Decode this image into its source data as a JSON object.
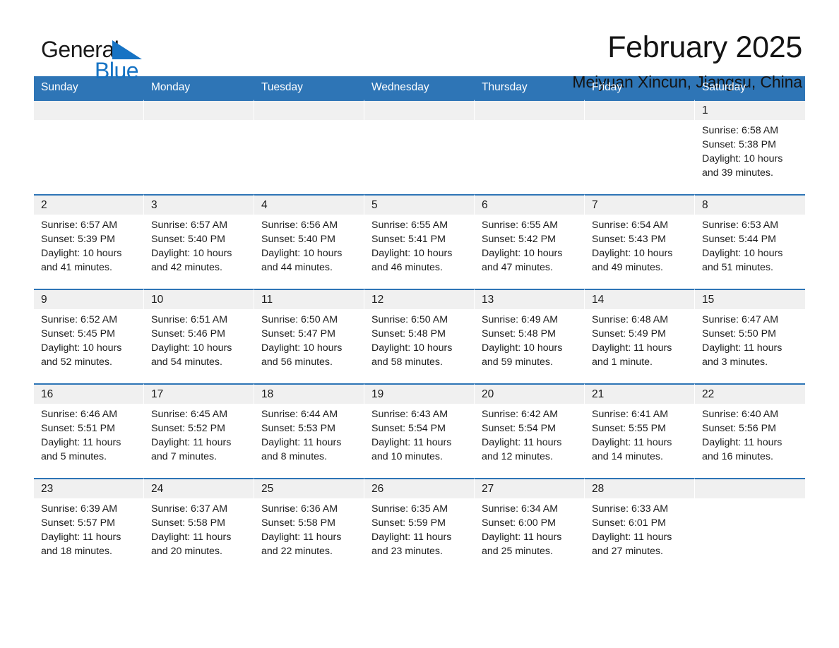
{
  "brand": {
    "word_one": "General",
    "word_two": "Blue",
    "triangle_icon": "triangle-icon"
  },
  "header": {
    "title": "February 2025",
    "subtitle": "Meiyuan Xincun, Jiangsu, China"
  },
  "colors": {
    "header_blue": "#2e75b6",
    "row_border_blue": "#2e75b6",
    "daynum_band": "#f0f0f0",
    "brand_blue": "#1673c4"
  },
  "calendar": {
    "weekday_headers": [
      "Sunday",
      "Monday",
      "Tuesday",
      "Wednesday",
      "Thursday",
      "Friday",
      "Saturday"
    ],
    "weeks": [
      [
        {
          "day": "",
          "sunrise": "",
          "sunset": "",
          "daylight": ""
        },
        {
          "day": "",
          "sunrise": "",
          "sunset": "",
          "daylight": ""
        },
        {
          "day": "",
          "sunrise": "",
          "sunset": "",
          "daylight": ""
        },
        {
          "day": "",
          "sunrise": "",
          "sunset": "",
          "daylight": ""
        },
        {
          "day": "",
          "sunrise": "",
          "sunset": "",
          "daylight": ""
        },
        {
          "day": "",
          "sunrise": "",
          "sunset": "",
          "daylight": ""
        },
        {
          "day": "1",
          "sunrise": "Sunrise: 6:58 AM",
          "sunset": "Sunset: 5:38 PM",
          "daylight": "Daylight: 10 hours and 39 minutes."
        }
      ],
      [
        {
          "day": "2",
          "sunrise": "Sunrise: 6:57 AM",
          "sunset": "Sunset: 5:39 PM",
          "daylight": "Daylight: 10 hours and 41 minutes."
        },
        {
          "day": "3",
          "sunrise": "Sunrise: 6:57 AM",
          "sunset": "Sunset: 5:40 PM",
          "daylight": "Daylight: 10 hours and 42 minutes."
        },
        {
          "day": "4",
          "sunrise": "Sunrise: 6:56 AM",
          "sunset": "Sunset: 5:40 PM",
          "daylight": "Daylight: 10 hours and 44 minutes."
        },
        {
          "day": "5",
          "sunrise": "Sunrise: 6:55 AM",
          "sunset": "Sunset: 5:41 PM",
          "daylight": "Daylight: 10 hours and 46 minutes."
        },
        {
          "day": "6",
          "sunrise": "Sunrise: 6:55 AM",
          "sunset": "Sunset: 5:42 PM",
          "daylight": "Daylight: 10 hours and 47 minutes."
        },
        {
          "day": "7",
          "sunrise": "Sunrise: 6:54 AM",
          "sunset": "Sunset: 5:43 PM",
          "daylight": "Daylight: 10 hours and 49 minutes."
        },
        {
          "day": "8",
          "sunrise": "Sunrise: 6:53 AM",
          "sunset": "Sunset: 5:44 PM",
          "daylight": "Daylight: 10 hours and 51 minutes."
        }
      ],
      [
        {
          "day": "9",
          "sunrise": "Sunrise: 6:52 AM",
          "sunset": "Sunset: 5:45 PM",
          "daylight": "Daylight: 10 hours and 52 minutes."
        },
        {
          "day": "10",
          "sunrise": "Sunrise: 6:51 AM",
          "sunset": "Sunset: 5:46 PM",
          "daylight": "Daylight: 10 hours and 54 minutes."
        },
        {
          "day": "11",
          "sunrise": "Sunrise: 6:50 AM",
          "sunset": "Sunset: 5:47 PM",
          "daylight": "Daylight: 10 hours and 56 minutes."
        },
        {
          "day": "12",
          "sunrise": "Sunrise: 6:50 AM",
          "sunset": "Sunset: 5:48 PM",
          "daylight": "Daylight: 10 hours and 58 minutes."
        },
        {
          "day": "13",
          "sunrise": "Sunrise: 6:49 AM",
          "sunset": "Sunset: 5:48 PM",
          "daylight": "Daylight: 10 hours and 59 minutes."
        },
        {
          "day": "14",
          "sunrise": "Sunrise: 6:48 AM",
          "sunset": "Sunset: 5:49 PM",
          "daylight": "Daylight: 11 hours and 1 minute."
        },
        {
          "day": "15",
          "sunrise": "Sunrise: 6:47 AM",
          "sunset": "Sunset: 5:50 PM",
          "daylight": "Daylight: 11 hours and 3 minutes."
        }
      ],
      [
        {
          "day": "16",
          "sunrise": "Sunrise: 6:46 AM",
          "sunset": "Sunset: 5:51 PM",
          "daylight": "Daylight: 11 hours and 5 minutes."
        },
        {
          "day": "17",
          "sunrise": "Sunrise: 6:45 AM",
          "sunset": "Sunset: 5:52 PM",
          "daylight": "Daylight: 11 hours and 7 minutes."
        },
        {
          "day": "18",
          "sunrise": "Sunrise: 6:44 AM",
          "sunset": "Sunset: 5:53 PM",
          "daylight": "Daylight: 11 hours and 8 minutes."
        },
        {
          "day": "19",
          "sunrise": "Sunrise: 6:43 AM",
          "sunset": "Sunset: 5:54 PM",
          "daylight": "Daylight: 11 hours and 10 minutes."
        },
        {
          "day": "20",
          "sunrise": "Sunrise: 6:42 AM",
          "sunset": "Sunset: 5:54 PM",
          "daylight": "Daylight: 11 hours and 12 minutes."
        },
        {
          "day": "21",
          "sunrise": "Sunrise: 6:41 AM",
          "sunset": "Sunset: 5:55 PM",
          "daylight": "Daylight: 11 hours and 14 minutes."
        },
        {
          "day": "22",
          "sunrise": "Sunrise: 6:40 AM",
          "sunset": "Sunset: 5:56 PM",
          "daylight": "Daylight: 11 hours and 16 minutes."
        }
      ],
      [
        {
          "day": "23",
          "sunrise": "Sunrise: 6:39 AM",
          "sunset": "Sunset: 5:57 PM",
          "daylight": "Daylight: 11 hours and 18 minutes."
        },
        {
          "day": "24",
          "sunrise": "Sunrise: 6:37 AM",
          "sunset": "Sunset: 5:58 PM",
          "daylight": "Daylight: 11 hours and 20 minutes."
        },
        {
          "day": "25",
          "sunrise": "Sunrise: 6:36 AM",
          "sunset": "Sunset: 5:58 PM",
          "daylight": "Daylight: 11 hours and 22 minutes."
        },
        {
          "day": "26",
          "sunrise": "Sunrise: 6:35 AM",
          "sunset": "Sunset: 5:59 PM",
          "daylight": "Daylight: 11 hours and 23 minutes."
        },
        {
          "day": "27",
          "sunrise": "Sunrise: 6:34 AM",
          "sunset": "Sunset: 6:00 PM",
          "daylight": "Daylight: 11 hours and 25 minutes."
        },
        {
          "day": "28",
          "sunrise": "Sunrise: 6:33 AM",
          "sunset": "Sunset: 6:01 PM",
          "daylight": "Daylight: 11 hours and 27 minutes."
        },
        {
          "day": "",
          "sunrise": "",
          "sunset": "",
          "daylight": ""
        }
      ]
    ]
  }
}
